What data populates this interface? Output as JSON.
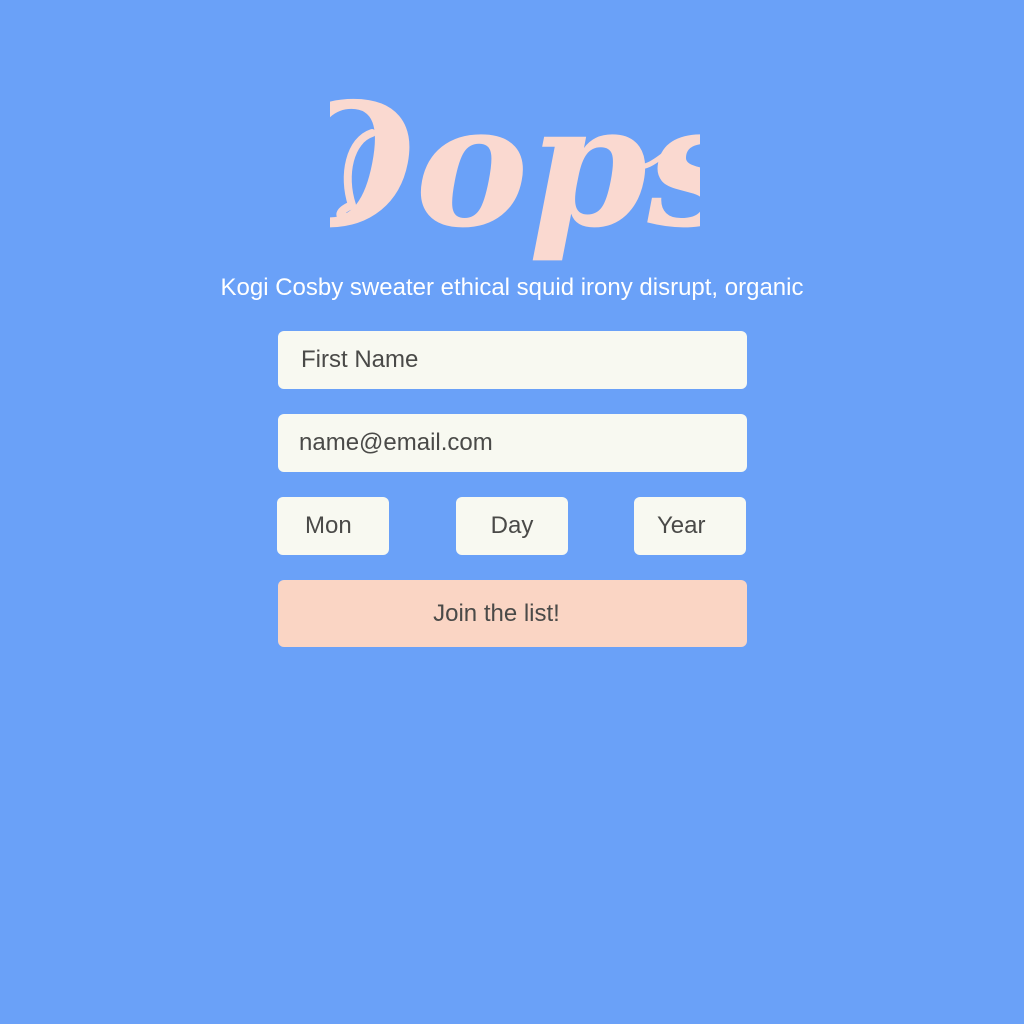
{
  "colors": {
    "background": "#6aa1f8",
    "logo": "#fad9d0",
    "field_bg": "#f8f9f1",
    "button_bg": "#fad5c4",
    "text_dark": "#4a4a48",
    "tagline": "#ffffff"
  },
  "logo": {
    "text": "Oops"
  },
  "tagline": "Kogi Cosby sweater ethical squid irony disrupt, organic",
  "form": {
    "first_name": "First Name",
    "email": "name@email.com",
    "month": "Mon",
    "day": "Day",
    "year": "Year",
    "submit_label": "Join the list!"
  }
}
